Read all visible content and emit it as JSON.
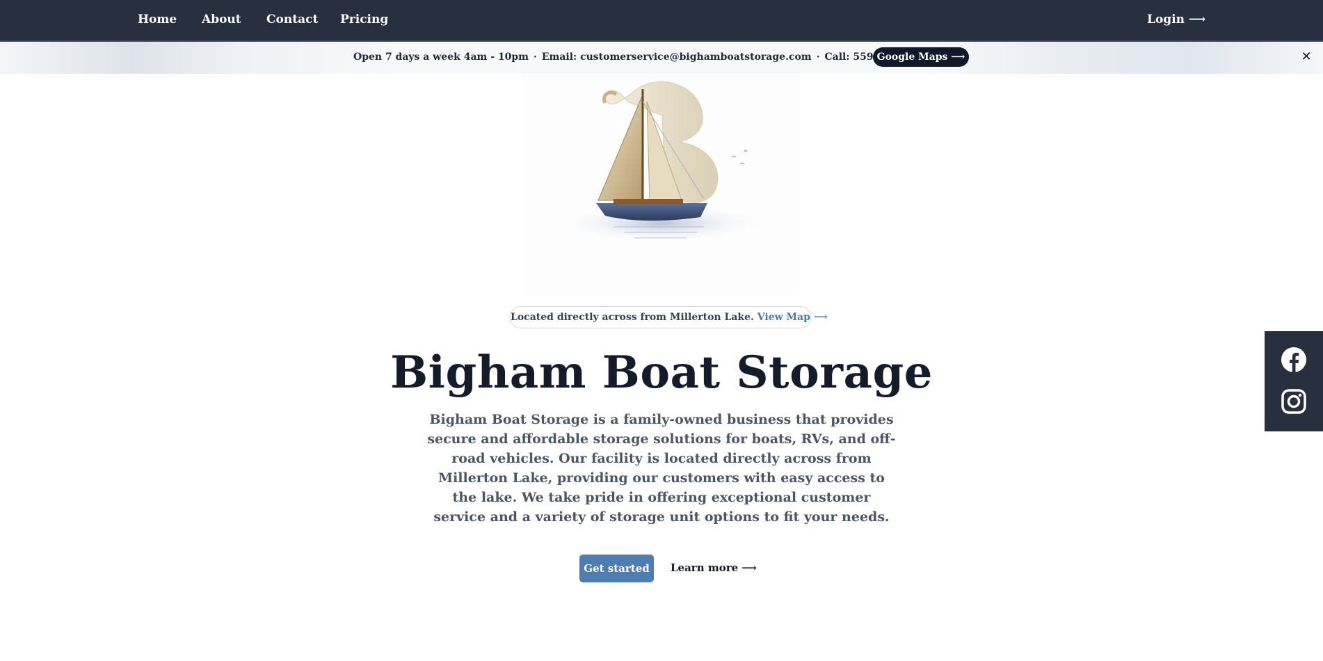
{
  "nav": {
    "items": [
      "Home",
      "About",
      "Contact",
      "Pricing"
    ],
    "login": "Login ⟶"
  },
  "banner": {
    "hours": "Open 7 days a week 4am - 10pm",
    "separator": "·",
    "email": "Email: customerservice@bighamboatstorage.com",
    "phone": "Call: 559-365-3726",
    "maps_button": "Google Maps ⟶",
    "close": "✕"
  },
  "hero": {
    "location_text": "Located directly across from Millerton Lake.",
    "view_map": "View Map ⟶",
    "title": "Bigham Boat Storage",
    "description": "Bigham Boat Storage is a family-owned business that provides secure and affordable storage solutions for boats, RVs, and off-road vehicles. Our facility is located directly across from Millerton Lake, providing our customers with easy access to the lake. We take pride in offering exceptional customer service and a variety of storage unit options to fit your needs.",
    "primary_button": "Get started",
    "secondary_button": "Learn more ⟶"
  },
  "social": {
    "icons": [
      "facebook-icon",
      "instagram-icon"
    ]
  },
  "colors": {
    "nav_bg": "#283040",
    "accent": "#4e7eb0",
    "link": "#4a78a8",
    "dark_button": "#111827"
  }
}
